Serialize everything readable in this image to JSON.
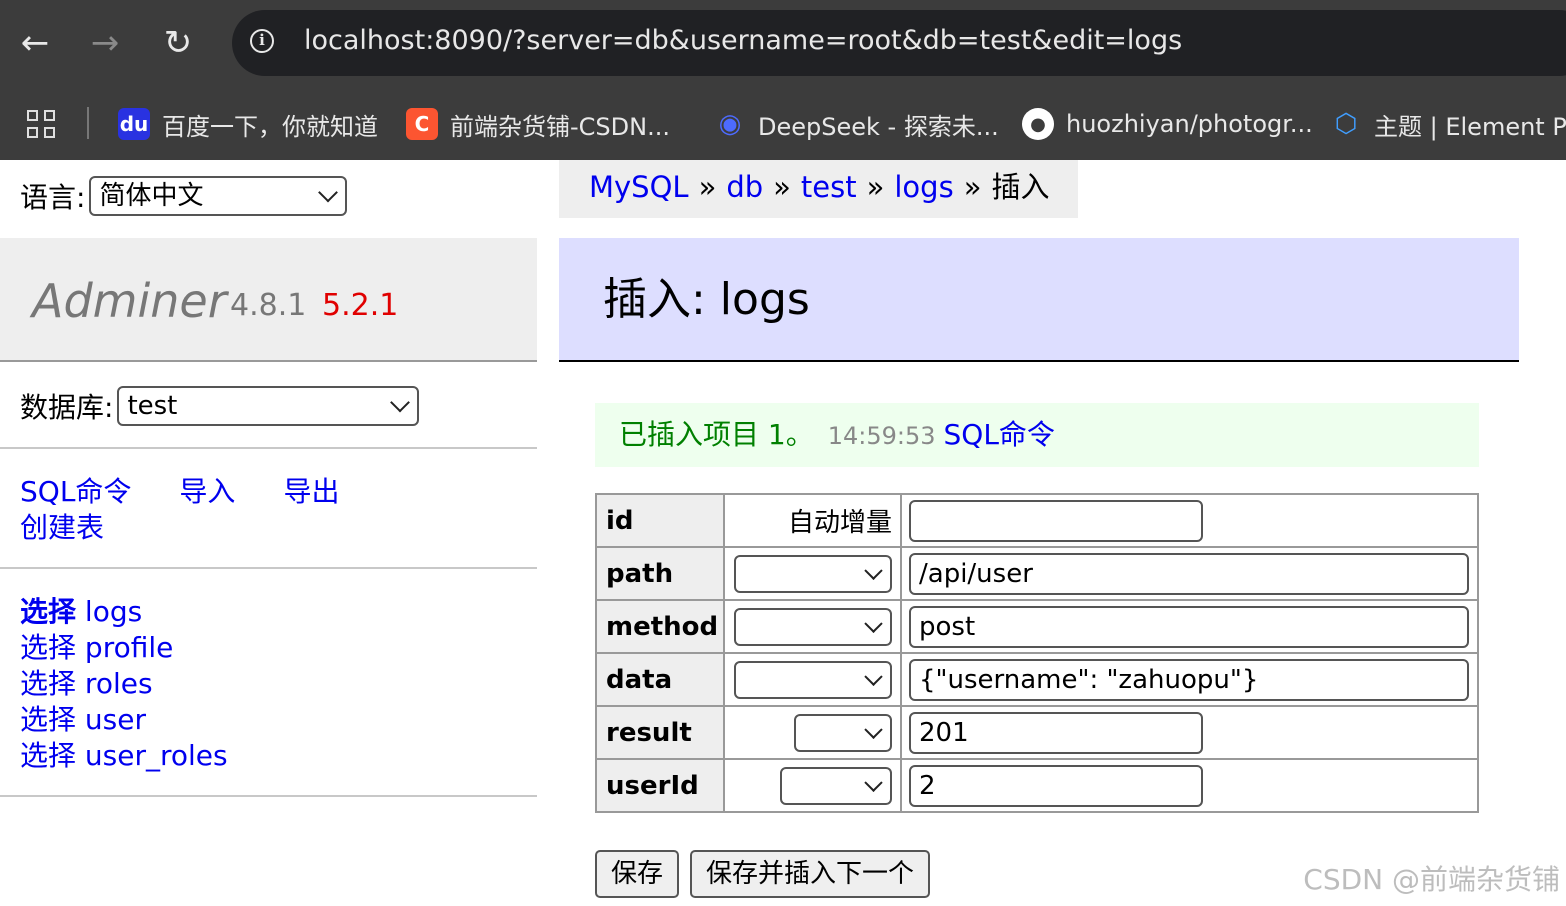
{
  "browser": {
    "url": "localhost:8090/?server=db&username=root&db=test&edit=logs",
    "bookmarks": [
      {
        "icon": "baidu-icon",
        "label": "百度一下，你就知道",
        "color": "#2932e1"
      },
      {
        "icon": "csdn-icon",
        "label": "前端杂货铺-CSDN...",
        "color": "#fc5531"
      },
      {
        "icon": "deepseek-icon",
        "label": "DeepSeek - 探索未...",
        "color": "#4d6bfe"
      },
      {
        "icon": "github-icon",
        "label": "huozhiyan/photogr...",
        "color": "#ffffff"
      },
      {
        "icon": "element-plus-icon",
        "label": "主题 | Element Plu",
        "color": "#409eff"
      }
    ]
  },
  "sidebar": {
    "language_label": "语言:",
    "language_value": "简体中文",
    "brand_name": "Adminer",
    "version": "4.8.1",
    "new_version": "5.2.1",
    "db_label": "数据库:",
    "db_value": "test",
    "commands": [
      "SQL命令",
      "导入",
      "导出"
    ],
    "create_table": "创建表",
    "select_label": "选择",
    "tables": [
      "logs",
      "profile",
      "roles",
      "user",
      "user_roles"
    ]
  },
  "breadcrumb": {
    "items": [
      "MySQL",
      "db",
      "test",
      "logs"
    ],
    "separator": "»",
    "current": "插入"
  },
  "main": {
    "title": "插入: logs",
    "message_text": "已插入项目 1。",
    "message_time": "14:59:53",
    "message_link": "SQL命令",
    "fields": [
      {
        "name": "id",
        "function": "自动增量",
        "value": ""
      },
      {
        "name": "path",
        "function": "",
        "value": "/api/user"
      },
      {
        "name": "method",
        "function": "",
        "value": "post"
      },
      {
        "name": "data",
        "function": "",
        "value": "{\"username\": \"zahuopu\"}"
      },
      {
        "name": "result",
        "function": "",
        "value": "201"
      },
      {
        "name": "userId",
        "function": "",
        "value": "2"
      }
    ],
    "save_label": "保存",
    "save_insert_label": "保存并插入下一个"
  },
  "watermark": "CSDN @前端杂货铺",
  "colors": {
    "link": "#0000ee",
    "heading_bg": "#dddeff",
    "message_bg": "#eeffee",
    "message_text": "#008000",
    "new_version": "#e00000"
  }
}
